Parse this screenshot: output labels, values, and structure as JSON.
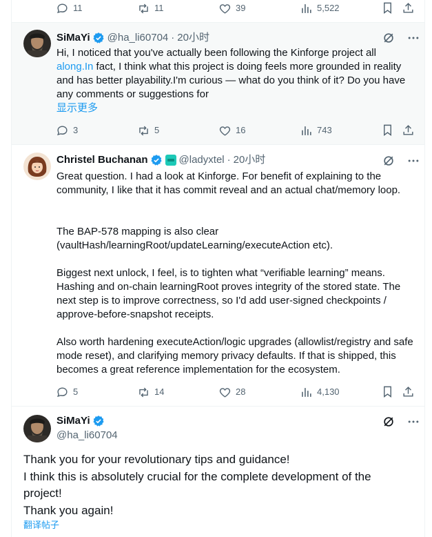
{
  "top_actions": {
    "replies": "11",
    "reposts": "11",
    "likes": "39",
    "views": "5,522"
  },
  "tweet1": {
    "name": "SiMaYi",
    "handle": "@ha_li60704",
    "time": "20小时",
    "text_a": "Hi, I noticed that you've actually been following the Kinforge project all",
    "text_link": "along.In",
    "text_b": " fact, I think what this project is doing feels more grounded in reality and has better playability.I'm curious — what do you think of it? Do you have any comments or suggestions for",
    "show_more": "显示更多",
    "replies": "3",
    "reposts": "5",
    "likes": "16",
    "views": "743"
  },
  "tweet2": {
    "name": "Christel Buchanan",
    "handle": "@ladyxtel",
    "time": "20小时",
    "p1": "Great question. I had a look at Kinforge. For benefit of explaining to the community, I like that it has commit reveal and an actual chat/memory loop.",
    "p2": "The BAP-578 mapping is also clear (vaultHash/learningRoot/updateLearning/executeAction etc).",
    "p3": "Biggest next unlock, I feel, is to tighten what “verifiable learning” means. Hashing and on-chain learningRoot proves integrity of the stored state. The next step is to improve correctness, so I'd add user-signed checkpoints / approve-before-snapshot receipts.",
    "p4": "Also worth hardening executeAction/logic upgrades (allowlist/registry and safe mode reset), and clarifying memory privacy defaults. If that is shipped, this becomes a great reference implementation for the ecosystem.",
    "replies": "5",
    "reposts": "14",
    "likes": "28",
    "views": "4,130"
  },
  "tweet3": {
    "name": "SiMaYi",
    "handle": "@ha_li60704",
    "line1": "Thank you for your revolutionary tips and guidance!",
    "line2": "I think this is absolutely crucial for the complete development of the project!",
    "line3": "Thank you again!",
    "translate": "翻译帖子"
  },
  "colors": {
    "accent": "#1d9bf0",
    "secondary_text": "#536471",
    "border": "#eff3f4",
    "highlight_bg": "#f7f9f9"
  }
}
